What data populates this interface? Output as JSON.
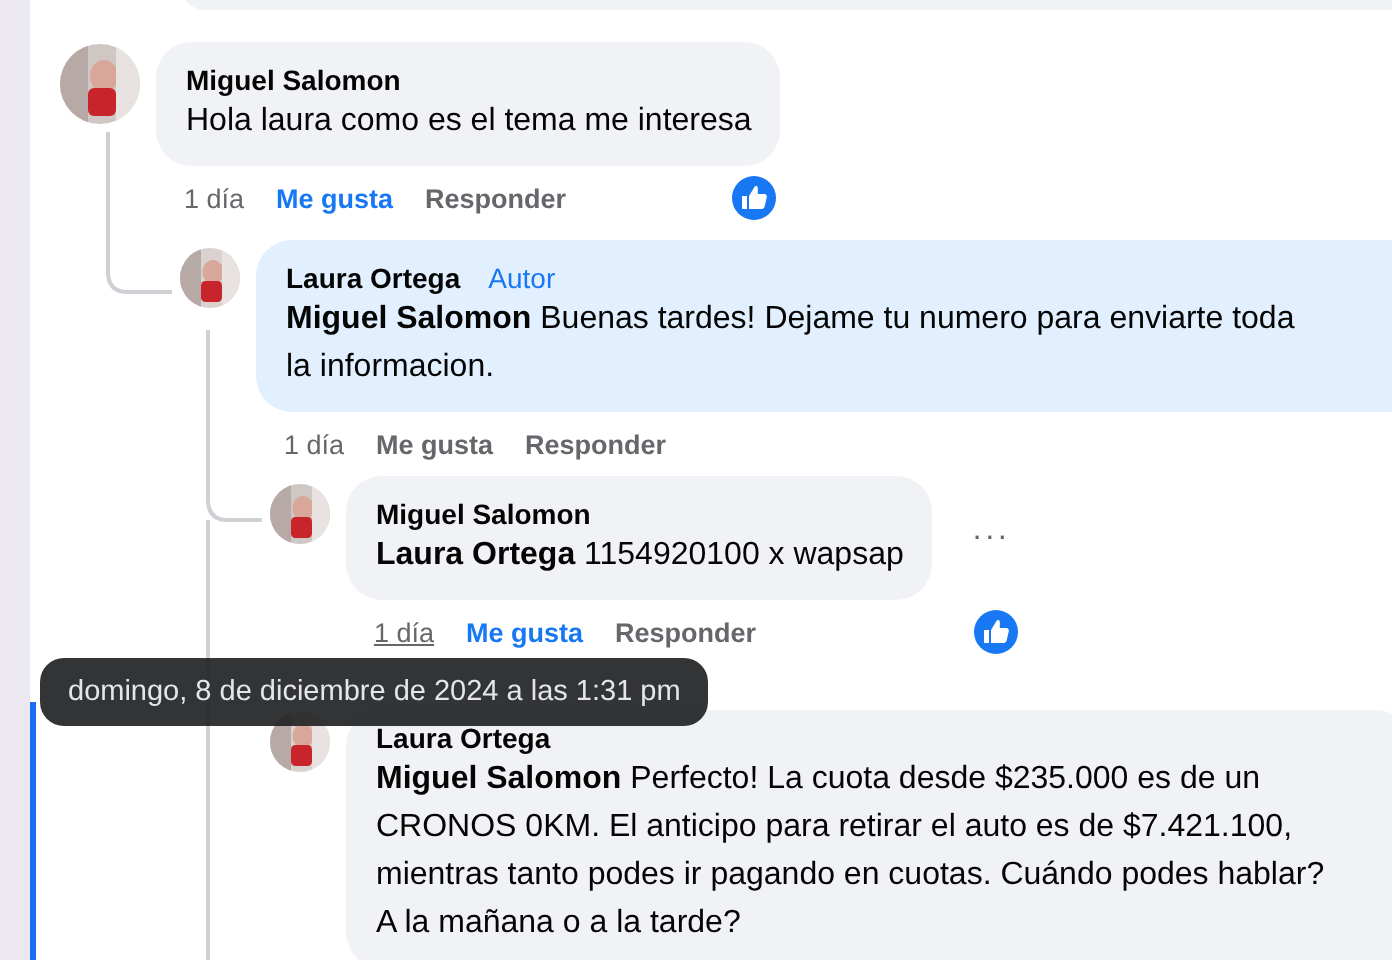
{
  "comments": [
    {
      "author": "Miguel Salomon",
      "text": "Hola laura como es el tema me interesa",
      "highlighted": false,
      "author_reply": false,
      "actions": {
        "time": "1 día",
        "time_hovered": false,
        "like": "Me gusta",
        "liked": true,
        "reply": "Responder",
        "reaction": true
      },
      "children": [
        {
          "author": "Laura Ortega",
          "badge": "Autor",
          "mention": "Miguel Salomon",
          "text": "Buenas tardes! Dejame tu numero para enviarte toda la informacion.",
          "highlighted": false,
          "author_reply": true,
          "actions": {
            "time": "1 día",
            "time_hovered": false,
            "like": "Me gusta",
            "liked": false,
            "reply": "Responder",
            "reaction": false
          },
          "children": [
            {
              "author": "Miguel Salomon",
              "mention": "Laura Ortega",
              "text": "1154920100 x wapsap",
              "highlighted": false,
              "author_reply": false,
              "actions": {
                "time": "1 día",
                "time_hovered": true,
                "like": "Me gusta",
                "liked": true,
                "reply": "Responder",
                "reaction": true
              },
              "menu": "···"
            },
            {
              "author": "Laura Ortega",
              "mention": "Miguel Salomon",
              "text": "Perfecto! La cuota desde $235.000 es de un CRONOS 0KM. El anticipo para retirar el auto es de $7.421.100, mientras tanto podes ir pagando en cuotas. Cuándo podes hablar? A la mañana o a la tarde?",
              "highlighted": true,
              "author_reply": false
            }
          ]
        }
      ]
    }
  ],
  "tooltip": {
    "text": "domingo, 8 de diciembre de 2024 a las 1:31 pm"
  }
}
